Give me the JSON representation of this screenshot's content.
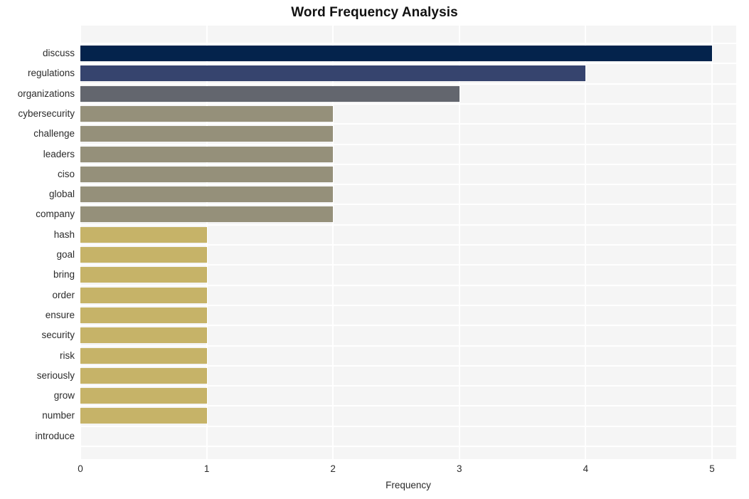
{
  "chart_data": {
    "type": "bar",
    "orientation": "horizontal",
    "title": "Word Frequency Analysis",
    "xlabel": "Frequency",
    "ylabel": "",
    "xlim": [
      0,
      5
    ],
    "xticks": [
      0,
      1,
      2,
      3,
      4,
      5
    ],
    "xtick_labels": [
      "0",
      "1",
      "2",
      "3",
      "4",
      "5"
    ],
    "grid": true,
    "legend": null,
    "categories": [
      "discuss",
      "regulations",
      "organizations",
      "cybersecurity",
      "challenge",
      "leaders",
      "ciso",
      "global",
      "company",
      "hash",
      "goal",
      "bring",
      "order",
      "ensure",
      "security",
      "risk",
      "seriously",
      "grow",
      "number",
      "introduce"
    ],
    "values": [
      5,
      4,
      3,
      2,
      2,
      2,
      2,
      2,
      2,
      1,
      1,
      1,
      1,
      1,
      1,
      1,
      1,
      1,
      1
    ],
    "bar_colors": [
      "#04234c",
      "#36446e",
      "#63666e",
      "#95907a",
      "#95907a",
      "#95907a",
      "#95907a",
      "#95907a",
      "#95907a",
      "#c6b368",
      "#c6b368",
      "#c6b368",
      "#c6b368",
      "#c6b368",
      "#c6b368",
      "#c6b368",
      "#c6b368",
      "#c6b368",
      "#c6b368"
    ],
    "plot_background": "#f5f5f5",
    "figure_background": "#ffffff",
    "gridline_color": "#ffffff"
  }
}
